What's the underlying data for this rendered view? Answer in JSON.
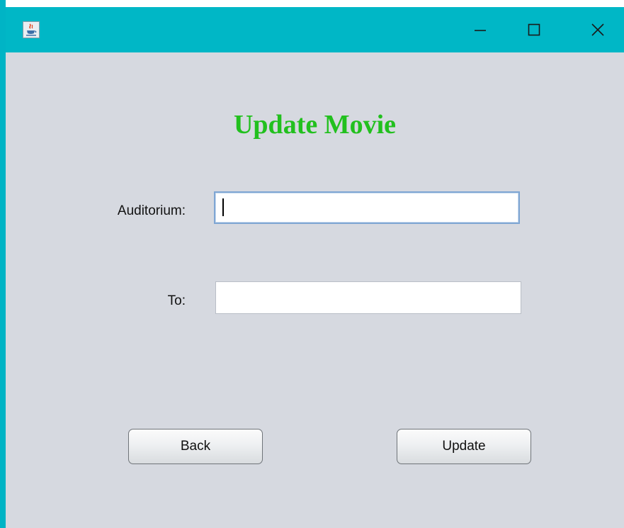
{
  "window": {
    "controls": {
      "minimize_icon": "minimize-icon",
      "maximize_icon": "maximize-icon",
      "close_icon": "close-icon"
    },
    "app_icon": "java-cup-icon",
    "titlebar_color": "#00b7c6"
  },
  "form": {
    "title": "Update Movie",
    "title_color": "#22c01e",
    "auditorium": {
      "label": "Auditorium:",
      "value": ""
    },
    "to": {
      "label": "To:",
      "value": ""
    }
  },
  "buttons": {
    "back_label": "Back",
    "update_label": "Update"
  }
}
